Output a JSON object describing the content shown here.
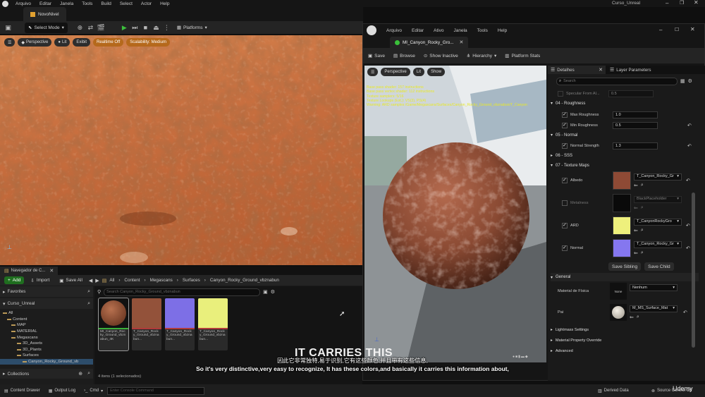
{
  "menubar": {
    "items": [
      "Arquivo",
      "Editar",
      "Janela",
      "Tools",
      "Build",
      "Select",
      "Actor",
      "Help"
    ],
    "project": "Curso_Unreal"
  },
  "level_tab": "NovoNivel",
  "toolbar": {
    "select_mode": "Select Mode",
    "platforms": "Platforms"
  },
  "viewport": {
    "perspective": "Perspective",
    "lit": "Lit",
    "exibit": "Exibit",
    "realtime": "Realtime Off",
    "scalability": "Scalability: Medium"
  },
  "content_browser": {
    "tab": "Navegador de C...",
    "add": "Add",
    "import": "Import",
    "save_all": "Save All",
    "breadcrumb": [
      "All",
      "Content",
      "Megascans",
      "Surfaces",
      "Canyon_Rocky_Ground_vbznabun"
    ],
    "favorites": "Favorites",
    "project": "Curso_Unreal",
    "tree": [
      "All",
      "Content",
      "MAP",
      "MATERIAL",
      "Megascans",
      "3D_Assets",
      "3D_Plants",
      "Surfaces",
      "Canyon_Rocky_Ground_vb"
    ],
    "search_placeholder": "Search Canyon_Rocky_Ground_vbznabun",
    "assets": [
      {
        "label": "MI_Canyon_Rocky_Ground_vbznabun_4K",
        "color": "#8a4a2e"
      },
      {
        "label": "T_Canyon_Rocky_Ground_vbznabun...",
        "color": "#93523a"
      },
      {
        "label": "T_Canyon_Rocky_Ground_vbznabun...",
        "color": "#7d6fe6"
      },
      {
        "label": "T_Canyon_Rocky_Ground_vbznabun...",
        "color": "#e9ef7c"
      }
    ],
    "status": "4 itens (1 selecionados)",
    "collections": "Collections"
  },
  "bottom_bar": {
    "content_drawer": "Content Drawer",
    "output_log": "Output Log",
    "cmd": "Cmd",
    "console_placeholder": "Enter Console Command",
    "derived_data": "Derived Data",
    "source_control": "Source Control Off"
  },
  "material_editor": {
    "menu": [
      "Arquivo",
      "Editar",
      "Ativo",
      "Janela",
      "Tools",
      "Help"
    ],
    "tab": "MI_Canyon_Rocky_Gro...",
    "toolbar": [
      "Save",
      "Browse",
      "Show Inactive",
      "Hierarchy",
      "Platform Stats"
    ],
    "viewport_buttons": [
      "Perspective",
      "Lit",
      "Show"
    ],
    "stats": [
      "Base pass shader: 157 instructions",
      "Base pass vertex shader: 112 instructions",
      "Texture samplers: 5/16",
      "Texture Lookups (Est.): VS(3), PS(4)",
      "Warning: ARD samples /Game/Megascans/Surfaces/Canyon_Rocky_Ground_vbznabun/T_Canyon"
    ],
    "details_tab": "Detalhes",
    "layer_tab": "Layer Parameters",
    "search_placeholder": "Search",
    "specular_label": "Specular From Al...",
    "specular_value": "0.5",
    "roughness_section": "04 - Roughness",
    "max_roughness_label": "Max Roughness",
    "max_roughness_value": "1.0",
    "min_roughness_label": "Min Roughness",
    "min_roughness_value": "0.5",
    "normal_section": "05 - Normal",
    "normal_strength_label": "Normal Strength",
    "normal_strength_value": "1.3",
    "sss_section": "06 - SSS",
    "texture_section": "07 - Texture Maps",
    "textures": [
      {
        "label": "Albedo",
        "value": "T_Canyon_Rocky_Gr",
        "color": "#8e4a35",
        "checked": true
      },
      {
        "label": "Metalness",
        "value": "BlackPlaceholder",
        "color": "#0a0a0a",
        "checked": false
      },
      {
        "label": "ARD",
        "value": "T_CanyonRockyGro",
        "color": "#eef07c",
        "checked": true
      },
      {
        "label": "Normal",
        "value": "T_Canyon_Rocky_Gr",
        "color": "#8577ef",
        "checked": true
      }
    ],
    "save_sibling": "Save Sibling",
    "save_child": "Save Child",
    "general_section": "General",
    "phys_mat_label": "Material de Física",
    "phys_mat_value": "Nenhum",
    "phys_mat_thumb": "None",
    "parent_label": "Pai",
    "parent_value": "M_MS_Surface_Mat",
    "lightmass": "Lightmass Settings",
    "mat_prop_override": "Material Property Override",
    "advanced": "Advanced"
  },
  "subtitles": {
    "overlay": "IT CARRIES THIS",
    "chinese": "因此它非常独特,易于识别,它有这些颜色,并且带有这些信息,",
    "english": "So it's very distinctive,very easy to recognize, It has these colors,and basically it carries this information about,"
  },
  "watermark": "Udemy"
}
